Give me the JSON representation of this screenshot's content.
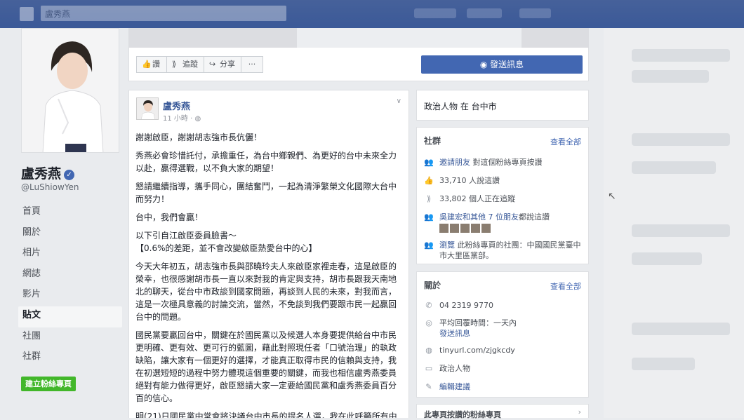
{
  "topbar": {
    "search_placeholder": "盧秀燕"
  },
  "profile": {
    "name": "盧秀燕",
    "handle": "@LuShiowYen",
    "create_page_label": "建立粉絲專頁"
  },
  "nav": [
    "首頁",
    "關於",
    "相片",
    "網誌",
    "影片",
    "貼文",
    "社團",
    "社群"
  ],
  "actions": {
    "like": "讚",
    "follow": "追蹤",
    "share": "分享",
    "more": "···",
    "message": "發送訊息"
  },
  "post": {
    "author": "盧秀燕",
    "time": "11 小時 ·",
    "p1": "謝謝啟臣，謝謝胡志強市長伉儷！",
    "p2": "秀燕必會珍惜託付，承擔重任，為台中鄉親們、為更好的台中未來全力以赴，贏得選戰，以不負大家的期望！",
    "p3": "懇請繼續指導，攜手同心，團結奮鬥，一起為清淨繁榮文化國際大台中而努力！",
    "p4": "台中，我們會贏！",
    "p5a": "以下引自江啟臣委員臉書～",
    "p5b": "【0.6%的差距，並不會改變啟臣熱愛台中的心】",
    "p6": "今天大年初五，胡志強市長與邵曉玲夫人來啟臣家裡走春，這是啟臣的榮幸，也很感謝胡市長一直以來對我的肯定與支持，胡市長跟我天南地北的聊天，從台中市政談到國家問題，再談到人民的未來，對我而言，這是一次極具意義的討論交流，當然，不免談到我們要跟市民一起贏回台中的問題。",
    "p7": "國民黨要贏回台中，關鍵在於國民黨以及候選人本身要提供給台中市民更明確、更有效、更可行的藍圖，藉此對照現任者「口號治理」的執政缺陷，讓大家有一個更好的選擇，才能真正取得市民的信賴與支持，我在初選短短的過程中努力體現這個重要的關鍵，而我也相信盧秀燕委員絕對有能力做得更好，啟臣懇請大家一定要給國民黨和盧秀燕委員百分百的信心。",
    "p8": "明(21)日國民黨中常會將決議台中市長的提名人選，我在此呼籲所有中"
  },
  "category_card": {
    "text": "政治人物 在 台中市"
  },
  "community": {
    "title": "社群",
    "see_all": "查看全部",
    "invite_link": "邀請朋友",
    "invite_rest": " 對這個粉絲專頁按讚",
    "likes": "33,710 人說這讚",
    "follows": "33,802 個人正在追蹤",
    "friends_link": "吳建宏和其他 7 位朋友",
    "friends_rest": "都說這讚",
    "group_link": "瀏覽",
    "group_rest": " 此粉絲專頁的社團：中國國民黨臺中市大里區黨部。"
  },
  "about": {
    "title": "關於",
    "see_all": "查看全部",
    "phone": "04 2319 9770",
    "response": "平均回覆時間：一天內",
    "send_message": "發送訊息",
    "website": "tinyurl.com/zjgkcdy",
    "category": "政治人物",
    "suggest_edit": "編輯建議"
  },
  "bottom_card": {
    "title": "此專頁按讚的粉絲專頁"
  }
}
